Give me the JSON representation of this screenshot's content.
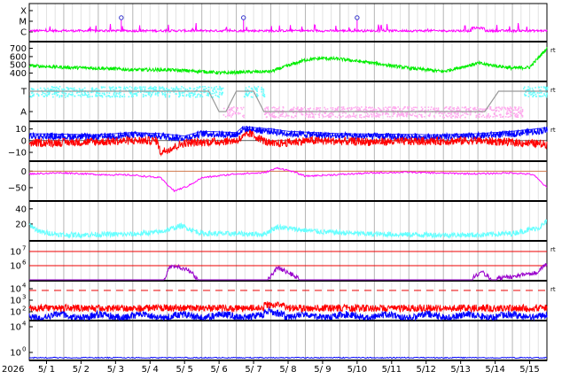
{
  "chart_data": {
    "type": "line",
    "x_axis": {
      "year_label": "2026",
      "start": "2026-05-01",
      "end": "2026-05-16",
      "ticks": [
        "5/ 1",
        "5/ 2",
        "5/ 3",
        "5/ 4",
        "5/ 5",
        "5/ 6",
        "5/ 7",
        "5/ 8",
        "5/ 9",
        "5/10",
        "5/11",
        "5/12",
        "5/13",
        "5/14",
        "5/15"
      ]
    },
    "colors": {
      "magenta": "#ff00ff",
      "green": "#00ee00",
      "cyan": "#66ffff",
      "pink": "#ffaaee",
      "gray": "#999999",
      "blue": "#0000ff",
      "red": "#ff0000",
      "purple": "#9900cc",
      "darkgray": "#666666"
    },
    "panels": [
      {
        "id": "flare-class",
        "scale": "categorical",
        "tick_labels": [
          "X",
          "M",
          "C"
        ],
        "series": [
          {
            "color": "magenta"
          }
        ],
        "circle_markers": [
          "2026-05-03T16:00",
          "2026-05-07T05:00",
          "2026-05-10T12:00"
        ],
        "rt": false
      },
      {
        "id": "solar-wind-speed",
        "scale": "linear",
        "ylim": [
          320,
          760
        ],
        "tick_labels": [
          "700",
          "600",
          "500",
          "400"
        ],
        "tick_values": [
          700,
          600,
          500,
          400
        ],
        "series": [
          {
            "color": "green"
          }
        ],
        "rt": true
      },
      {
        "id": "sector-ta",
        "scale": "categorical",
        "tick_labels": [
          "T",
          "A"
        ],
        "series": [
          {
            "color": "cyan"
          },
          {
            "color": "pink"
          },
          {
            "color": "gray"
          }
        ],
        "rt": true
      },
      {
        "id": "imf",
        "scale": "linear",
        "ylim": [
          -16,
          15
        ],
        "tick_labels": [
          "10",
          "0",
          "−10"
        ],
        "tick_values": [
          10,
          0,
          -10
        ],
        "series": [
          {
            "color": "blue"
          },
          {
            "color": "red"
          }
        ],
        "rt": true
      },
      {
        "id": "dst",
        "scale": "linear",
        "ylim": [
          -85,
          25
        ],
        "tick_labels": [
          "0",
          "−50"
        ],
        "tick_values": [
          0,
          -50
        ],
        "series": [
          {
            "color": "magenta"
          }
        ],
        "rt": false
      },
      {
        "id": "ae",
        "scale": "linear",
        "ylim": [
          0,
          48
        ],
        "tick_labels": [
          "40",
          "20"
        ],
        "tick_values": [
          40,
          20
        ],
        "series": [
          {
            "color": "cyan"
          }
        ],
        "rt": false
      },
      {
        "id": "electron-flux",
        "scale": "log",
        "tick_labels": [
          "10",
          "10"
        ],
        "tick_exponents": [
          "7",
          "6"
        ],
        "series": [
          {
            "color": "purple"
          }
        ],
        "thresholds": [
          "1e7",
          "1e6"
        ],
        "rt": true
      },
      {
        "id": "proton-flux",
        "scale": "log",
        "tick_labels": [
          "10",
          "10",
          "10"
        ],
        "tick_exponents": [
          "4",
          "3",
          "2"
        ],
        "series": [
          {
            "color": "red"
          },
          {
            "color": "blue"
          }
        ],
        "thresholds": [
          "1e4"
        ],
        "rt": true
      },
      {
        "id": "neutron",
        "scale": "log",
        "tick_labels": [
          "10",
          "10"
        ],
        "tick_exponents": [
          "4",
          "0"
        ],
        "series": [
          {
            "color": "blue"
          }
        ],
        "rt": false
      }
    ],
    "rt_label": "rt",
    "grid": true
  }
}
